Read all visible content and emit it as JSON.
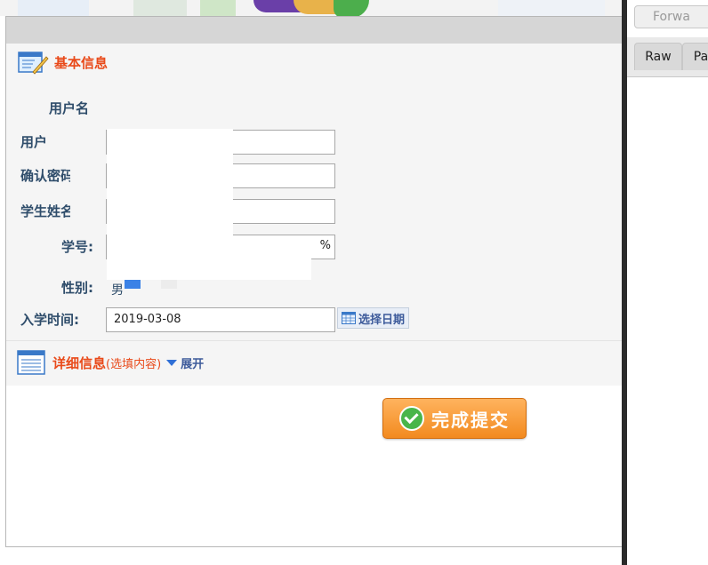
{
  "dialog": {
    "basic_section": {
      "title": "基本信息",
      "fields": {
        "username_label": "用户名",
        "password_label": "用户",
        "confirm_label": "确认密码",
        "name_label": "学生姓名",
        "student_id_label": "学号:",
        "student_id_tail": "%",
        "gender_label": "性别:",
        "gender_value": "男",
        "enroll_label": "入学时间:",
        "enroll_value": "2019-03-08",
        "date_picker_label": "选择日期"
      }
    },
    "detail_section": {
      "title": "详细信息",
      "optional_note": "(选填内容)",
      "expand_label": "展开"
    },
    "submit_label": "完成提交"
  },
  "devtools": {
    "forward_label": "Forwa",
    "tabs": [
      "Raw",
      "Pa"
    ]
  },
  "colors": {
    "accent": "#e94a1a",
    "label": "#2f4d6b",
    "submit": "#f28a1f"
  }
}
